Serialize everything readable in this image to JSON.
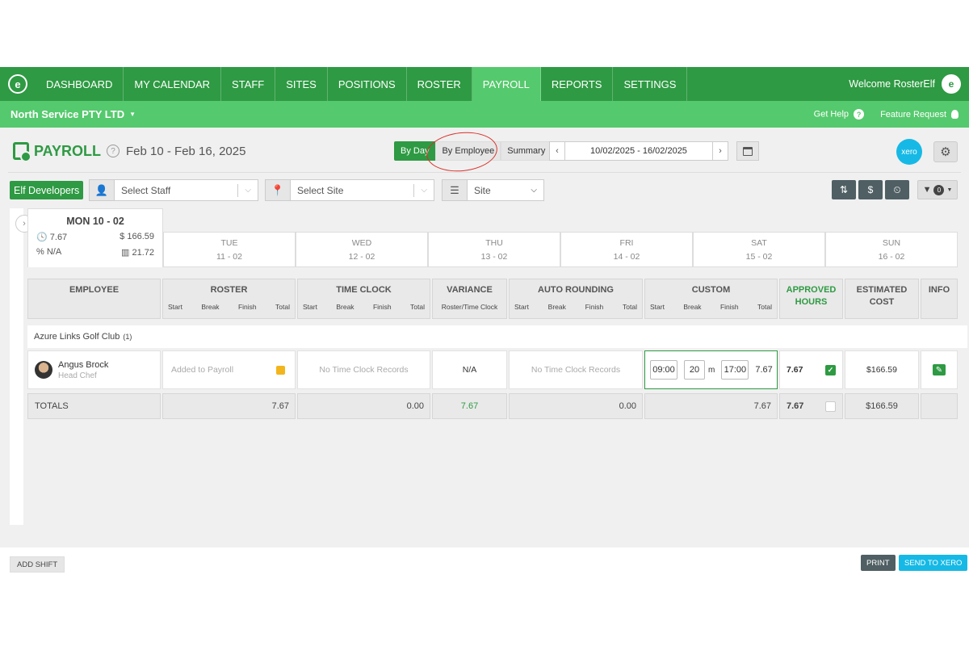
{
  "nav": {
    "items": [
      {
        "label": "DASHBOARD"
      },
      {
        "label": "MY CALENDAR"
      },
      {
        "label": "STAFF"
      },
      {
        "label": "SITES"
      },
      {
        "label": "POSITIONS"
      },
      {
        "label": "ROSTER"
      },
      {
        "label": "PAYROLL",
        "active": true
      },
      {
        "label": "REPORTS"
      },
      {
        "label": "SETTINGS"
      }
    ],
    "welcome": "Welcome RosterElf"
  },
  "subbar": {
    "company": "North Service PTY LTD",
    "get_help": "Get Help",
    "feature_request": "Feature Request"
  },
  "header": {
    "title": "PAYROLL",
    "range": "Feb 10 - Feb 16, 2025",
    "view_by_day": "By Day",
    "view_by_employee": "By Employee",
    "view_summary": "Summary",
    "date_range": "10/02/2025 - 16/02/2025",
    "xero_label": "xero"
  },
  "filters": {
    "org": "Elf Developers",
    "staff_placeholder": "Select Staff",
    "site_placeholder": "Select Site",
    "group_by": "Site",
    "filter_count": "0"
  },
  "days": {
    "mon": {
      "title": "MON 10 - 02",
      "hours": "7.67",
      "cost": "166.59",
      "percent": "N/A",
      "chart": "21.72"
    },
    "others": [
      {
        "name": "TUE",
        "date": "11 - 02"
      },
      {
        "name": "WED",
        "date": "12 - 02"
      },
      {
        "name": "THU",
        "date": "13 - 02"
      },
      {
        "name": "FRI",
        "date": "14 - 02"
      },
      {
        "name": "SAT",
        "date": "15 - 02"
      },
      {
        "name": "SUN",
        "date": "16 - 02"
      }
    ]
  },
  "columns": {
    "employee": "EMPLOYEE",
    "roster": "ROSTER",
    "time_clock": "TIME CLOCK",
    "variance": "VARIANCE",
    "variance_sub": "Roster/Time Clock",
    "auto_rounding": "AUTO ROUNDING",
    "custom": "CUSTOM",
    "approved_1": "APPROVED",
    "approved_2": "HOURS",
    "estimated_1": "ESTIMATED",
    "estimated_2": "COST",
    "info": "INFO",
    "start": "Start",
    "break": "Break",
    "finish": "Finish",
    "total": "Total"
  },
  "group": {
    "name": "Azure Links Golf Club",
    "count": "(1)"
  },
  "row": {
    "name": "Angus Brock",
    "position": "Head Chef",
    "roster": "Added to Payroll",
    "time_clock": "No Time Clock Records",
    "variance": "N/A",
    "auto_rounding": "No Time Clock Records",
    "custom_start": "09:00",
    "custom_break": "20",
    "custom_break_unit": "m",
    "custom_finish": "17:00",
    "custom_total": "7.67",
    "approved": "7.67",
    "cost": "$166.59"
  },
  "totals": {
    "label": "TOTALS",
    "roster": "7.67",
    "time_clock": "0.00",
    "variance": "7.67",
    "auto_rounding": "0.00",
    "custom": "7.67",
    "approved": "7.67",
    "cost": "$166.59"
  },
  "bottom": {
    "add_shift": "ADD SHIFT",
    "print": "PRINT",
    "send_to_xero": "SEND TO XERO"
  },
  "colors": {
    "primary": "#2e9a43",
    "primary_light": "#55c96d",
    "xero": "#16b9e5",
    "dark_btn": "#4f5f64"
  }
}
